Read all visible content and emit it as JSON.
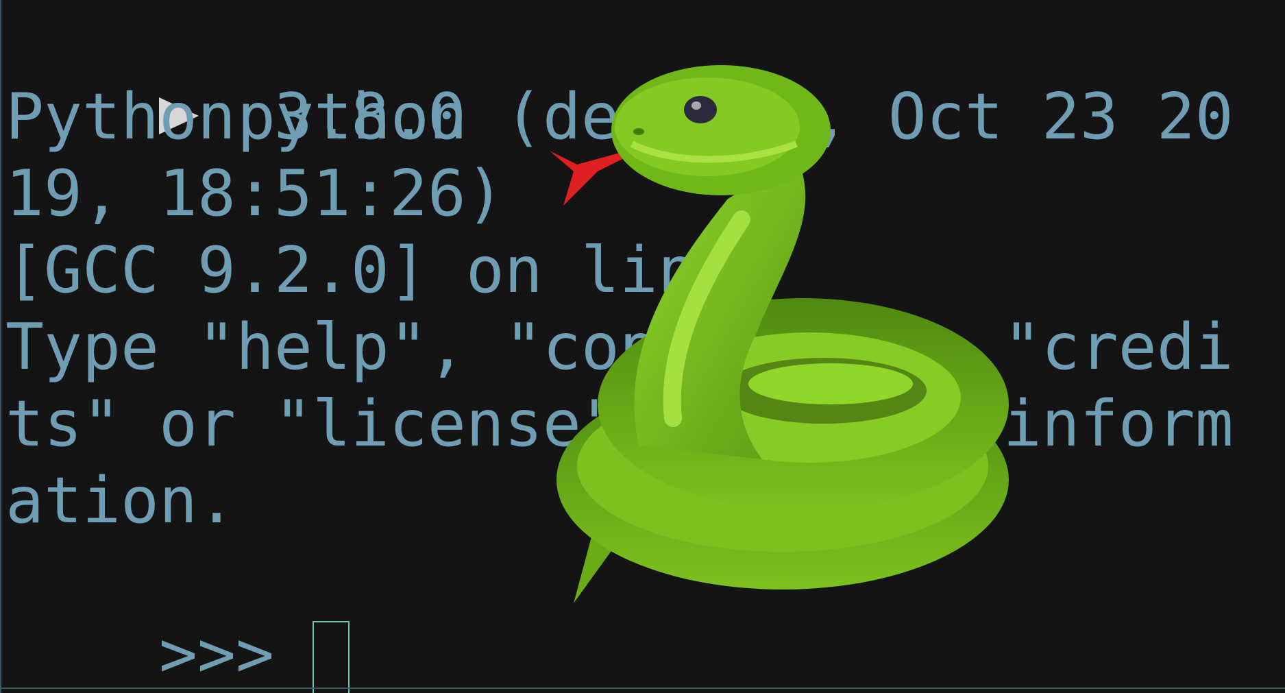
{
  "shell": {
    "command": "python"
  },
  "output": {
    "lines": [
      "Python 3.8.0 (default, Oct 23 20",
      "19, 18:51:26)",
      "[GCC 9.2.0] on linux",
      "Type \"help\", \"copyright\", \"credi",
      "ts\" or \"license\" for more inform",
      "ation."
    ]
  },
  "repl": {
    "prompt": ">>> "
  },
  "icons": {
    "prompt_marker": "play-triangle-icon",
    "overlay": "snake-icon"
  },
  "colors": {
    "background": "#141414",
    "text": "#6f9db3",
    "prompt_marker": "#d8d8d8",
    "cursor": "#6fc0a8",
    "snake_body": "#7cc21f",
    "snake_tongue": "#e02020"
  }
}
